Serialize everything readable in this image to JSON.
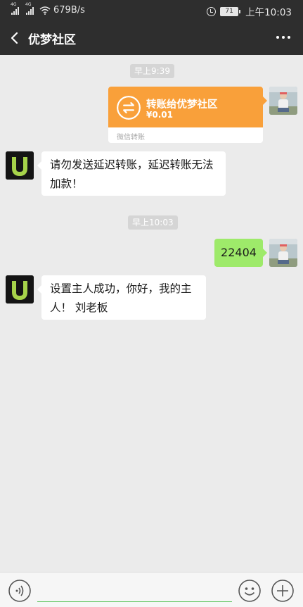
{
  "status_bar": {
    "network1": "4G",
    "network2": "4G",
    "speed": "679B/s",
    "battery": "71",
    "time": "上午10:03"
  },
  "header": {
    "title": "优梦社区"
  },
  "messages": {
    "timestamp1": "早上9:39",
    "transfer": {
      "title": "转账给优梦社区",
      "amount": "¥0.01",
      "footer": "微信转账"
    },
    "bot_reply1": [
      "请勿发送延迟转账，延迟转账无法",
      "加款！"
    ],
    "timestamp2": "早上10:03",
    "user_text": "22404",
    "bot_reply2": [
      "设置主人成功，你好，我的主",
      "人！ 刘老板"
    ]
  },
  "colors": {
    "header_bg": "#2e2e2e",
    "chat_bg": "#ebebeb",
    "transfer_orange": "#f9a03a",
    "sent_bubble": "#9eea6a",
    "input_underline": "#5ac35a",
    "bot_avatar_letter": "#a6d34a"
  },
  "icons": {
    "back": "chevron-left-icon",
    "more": "more-dots-icon",
    "transfer": "transfer-arrows-icon",
    "voice": "voice-icon",
    "emoji": "emoji-icon",
    "plus": "plus-icon"
  },
  "input": {
    "value": "",
    "placeholder": ""
  }
}
